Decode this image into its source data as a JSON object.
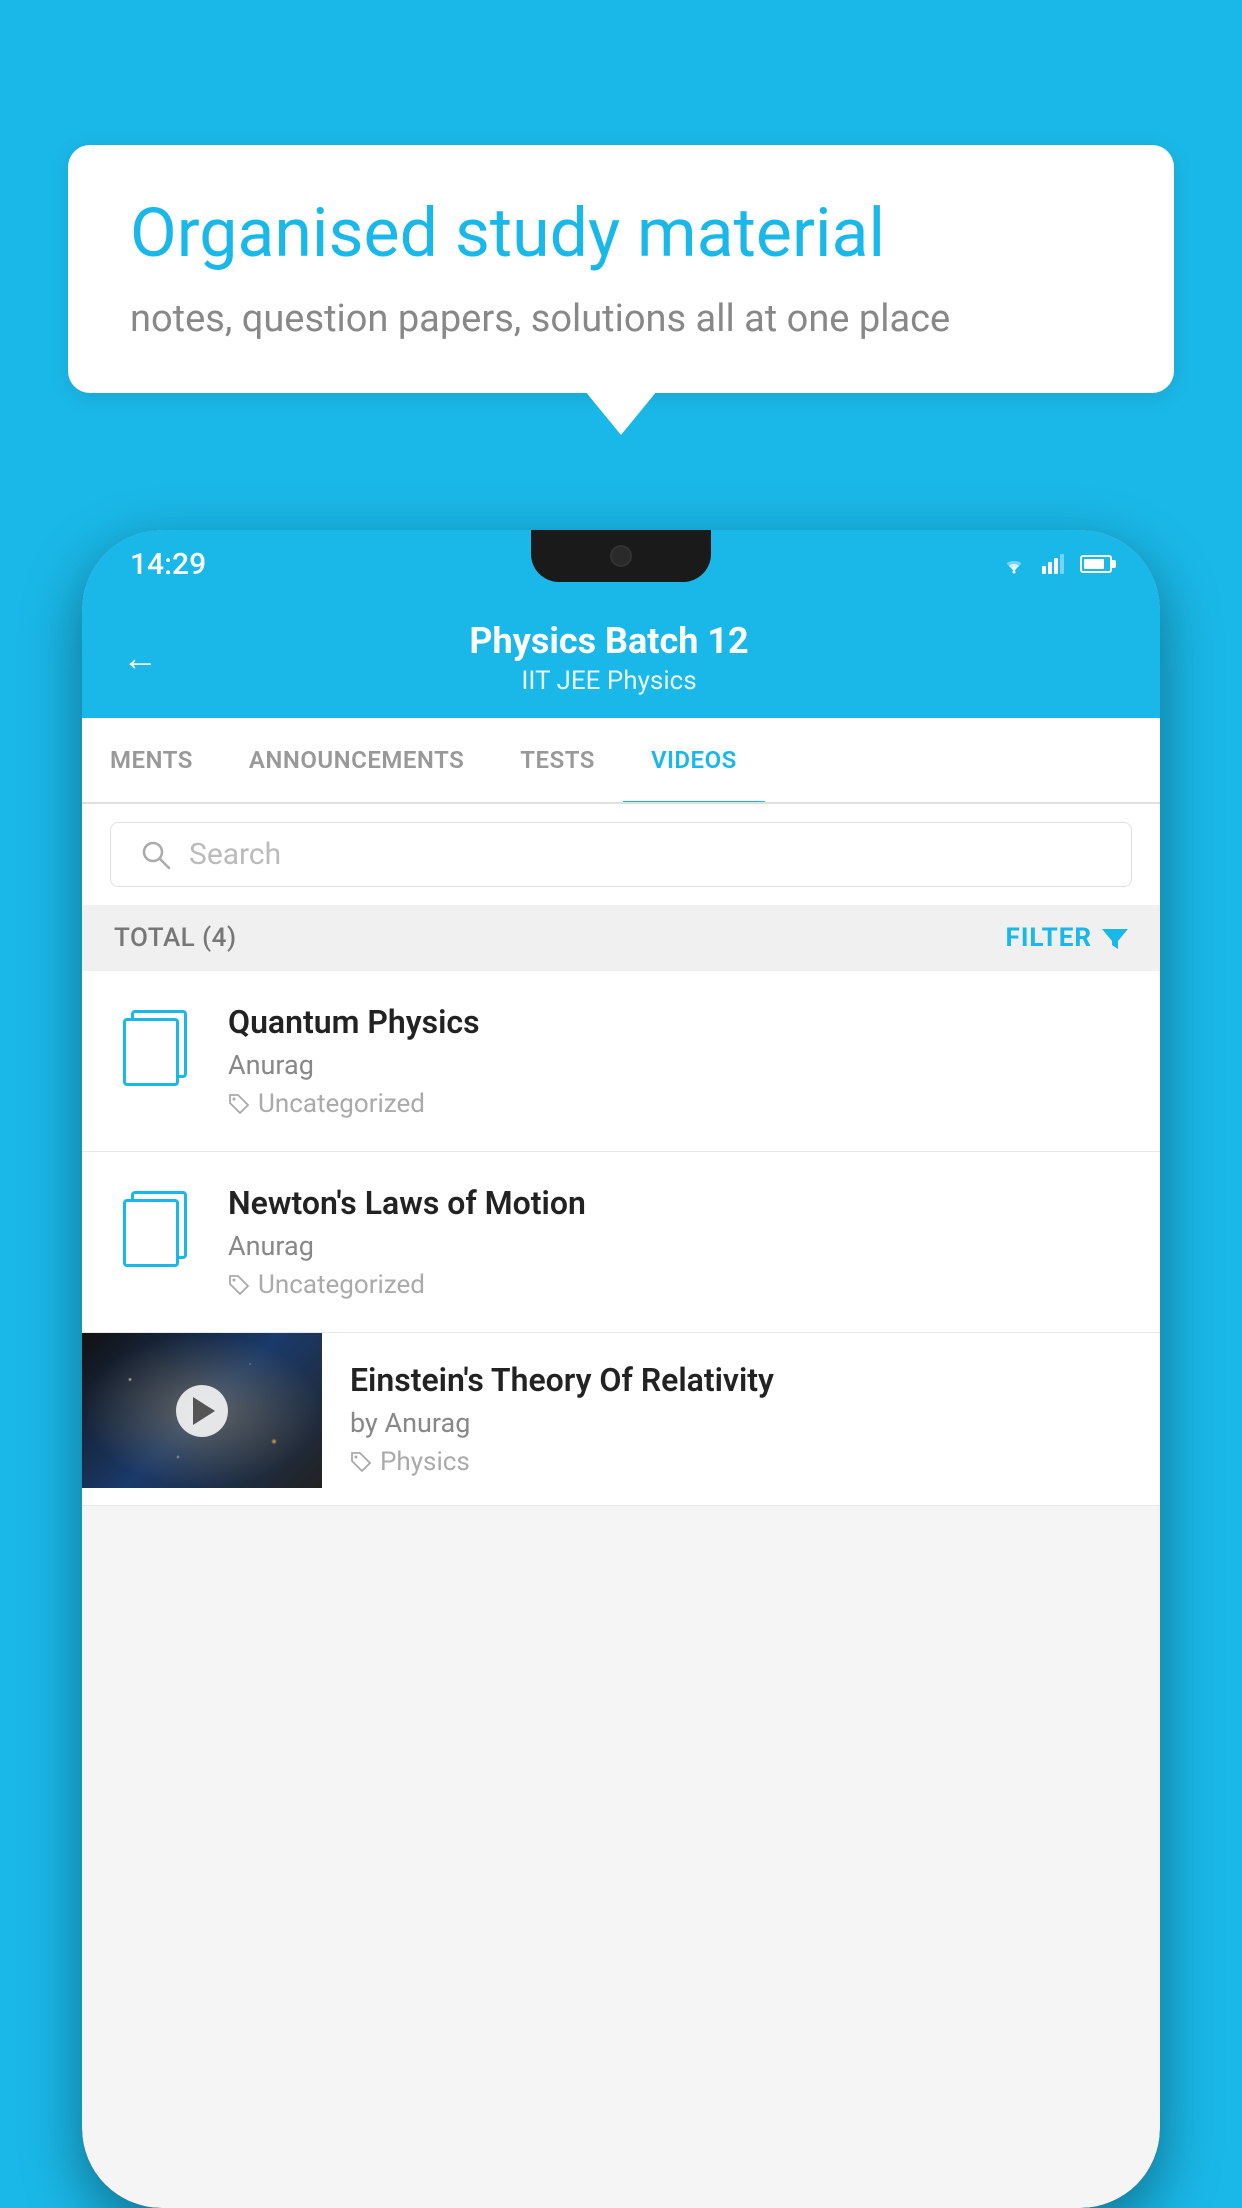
{
  "background": {
    "color": "#1ab8e8"
  },
  "speech_bubble": {
    "title": "Organised study material",
    "subtitle": "notes, question papers, solutions all at one place"
  },
  "phone": {
    "status_bar": {
      "time": "14:29"
    },
    "header": {
      "back_label": "←",
      "batch_name": "Physics Batch 12",
      "subtitle": "IIT JEE   Physics"
    },
    "tabs": [
      {
        "label": "MENTS",
        "active": false
      },
      {
        "label": "ANNOUNCEMENTS",
        "active": false
      },
      {
        "label": "TESTS",
        "active": false
      },
      {
        "label": "VIDEOS",
        "active": true
      }
    ],
    "search": {
      "placeholder": "Search"
    },
    "filter_row": {
      "total_label": "TOTAL (4)",
      "filter_label": "FILTER"
    },
    "video_items": [
      {
        "id": 1,
        "title": "Quantum Physics",
        "author": "Anurag",
        "tag": "Uncategorized",
        "has_thumbnail": false
      },
      {
        "id": 2,
        "title": "Newton's Laws of Motion",
        "author": "Anurag",
        "tag": "Uncategorized",
        "has_thumbnail": false
      },
      {
        "id": 3,
        "title": "Einstein's Theory Of Relativity",
        "author": "by Anurag",
        "tag": "Physics",
        "has_thumbnail": true
      }
    ]
  }
}
